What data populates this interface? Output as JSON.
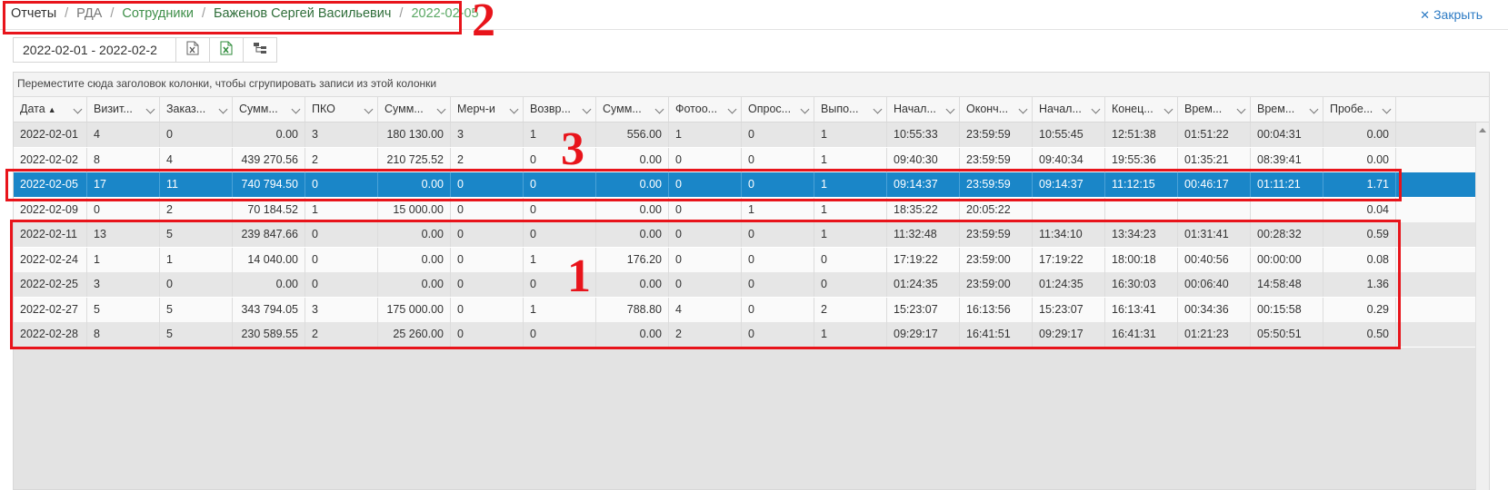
{
  "breadcrumb": {
    "items": [
      "Отчеты",
      "РДА",
      "Сотрудники",
      "Баженов Сергей Васильевич",
      "2022-02-05"
    ],
    "separator": "/"
  },
  "close_label": "Закрыть",
  "toolbar": {
    "date_range": "2022-02-01 - 2022-02-2",
    "buttons": [
      "export-excel-icon",
      "export-excel-green-icon",
      "hierarchy-icon"
    ]
  },
  "grid": {
    "group_panel_text": "Переместите сюда заголовок колонки, чтобы сгрупировать записи из этой колонки",
    "columns": [
      "Дата",
      "Визит...",
      "Заказ...",
      "Сумм...",
      "ПКО",
      "Сумм...",
      "Мерч-и",
      "Возвр...",
      "Сумм...",
      "Фотоо...",
      "Опрос...",
      "Выпо...",
      "Начал...",
      "Оконч...",
      "Начал...",
      "Конец...",
      "Врем...",
      "Врем...",
      "Пробе..."
    ],
    "sort_indicator": "▲",
    "rows": [
      [
        "2022-02-01",
        "4",
        "0",
        "0.00",
        "3",
        "180 130.00",
        "3",
        "1",
        "556.00",
        "1",
        "0",
        "1",
        "10:55:33",
        "23:59:59",
        "10:55:45",
        "12:51:38",
        "01:51:22",
        "00:04:31",
        "0.00"
      ],
      [
        "2022-02-02",
        "8",
        "4",
        "439 270.56",
        "2",
        "210 725.52",
        "2",
        "0",
        "0.00",
        "0",
        "0",
        "1",
        "09:40:30",
        "23:59:59",
        "09:40:34",
        "19:55:36",
        "01:35:21",
        "08:39:41",
        "0.00"
      ],
      [
        "2022-02-05",
        "17",
        "11",
        "740 794.50",
        "0",
        "0.00",
        "0",
        "0",
        "0.00",
        "0",
        "0",
        "1",
        "09:14:37",
        "23:59:59",
        "09:14:37",
        "11:12:15",
        "00:46:17",
        "01:11:21",
        "1.71"
      ],
      [
        "2022-02-09",
        "0",
        "2",
        "70 184.52",
        "1",
        "15 000.00",
        "0",
        "0",
        "0.00",
        "0",
        "1",
        "1",
        "18:35:22",
        "20:05:22",
        "",
        "",
        "",
        "",
        "0.04"
      ],
      [
        "2022-02-11",
        "13",
        "5",
        "239 847.66",
        "0",
        "0.00",
        "0",
        "0",
        "0.00",
        "0",
        "0",
        "1",
        "11:32:48",
        "23:59:59",
        "11:34:10",
        "13:34:23",
        "01:31:41",
        "00:28:32",
        "0.59"
      ],
      [
        "2022-02-24",
        "1",
        "1",
        "14 040.00",
        "0",
        "0.00",
        "0",
        "1",
        "176.20",
        "0",
        "0",
        "0",
        "17:19:22",
        "23:59:00",
        "17:19:22",
        "18:00:18",
        "00:40:56",
        "00:00:00",
        "0.08"
      ],
      [
        "2022-02-25",
        "3",
        "0",
        "0.00",
        "0",
        "0.00",
        "0",
        "0",
        "0.00",
        "0",
        "0",
        "0",
        "01:24:35",
        "23:59:00",
        "01:24:35",
        "16:30:03",
        "00:06:40",
        "14:58:48",
        "1.36"
      ],
      [
        "2022-02-27",
        "5",
        "5",
        "343 794.05",
        "3",
        "175 000.00",
        "0",
        "1",
        "788.80",
        "4",
        "0",
        "2",
        "15:23:07",
        "16:13:56",
        "15:23:07",
        "16:13:41",
        "00:34:36",
        "00:15:58",
        "0.29"
      ],
      [
        "2022-02-28",
        "8",
        "5",
        "230 589.55",
        "2",
        "25 260.00",
        "0",
        "0",
        "0.00",
        "2",
        "0",
        "1",
        "09:29:17",
        "16:41:51",
        "09:29:17",
        "16:41:31",
        "01:21:23",
        "05:50:51",
        "0.50"
      ]
    ],
    "selected_row_index": 2
  },
  "annotations": [
    "1",
    "2",
    "3"
  ],
  "colors": {
    "selected_row": "#1a86c8",
    "annotation_red": "#e8141b",
    "breadcrumb_green": "#3f8f4a",
    "link_blue": "#2d7bc4"
  }
}
